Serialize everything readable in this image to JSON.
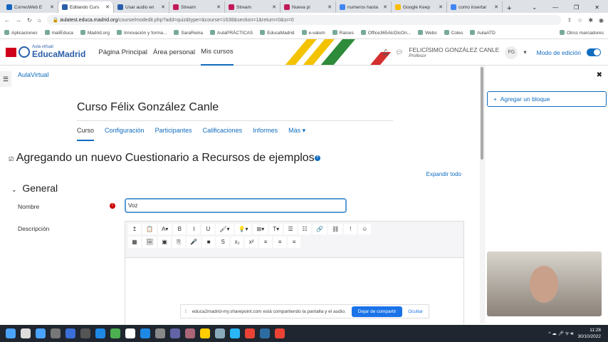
{
  "browser": {
    "tabs": [
      {
        "label": "CorreoWeb E",
        "color": "#1565c0"
      },
      {
        "label": "Editando Curs",
        "color": "#2a5ea8",
        "active": true
      },
      {
        "label": "Usar audio en",
        "color": "#2a5ea8"
      },
      {
        "label": "Stream",
        "color": "#c2185b"
      },
      {
        "label": "Stream",
        "color": "#c2185b"
      },
      {
        "label": "Nueva pi",
        "color": "#c2185b"
      },
      {
        "label": "numeros hasta",
        "color": "#4285f4"
      },
      {
        "label": "Google Keep",
        "color": "#fbbc04"
      },
      {
        "label": "como insertar",
        "color": "#4285f4"
      }
    ],
    "url_host": "aulatest.educa.madrid.org",
    "url_path": "/course/modedit.php?add=quiz&type=&course=1638&section=1&return=0&sr=0",
    "bookmarks": [
      "Aplicaciones",
      "mailEduca",
      "Madrid.org",
      "Innovación y forma...",
      "SaraReina",
      "AulaPRÁCTICAS",
      "EducaMadrid",
      "e-valum",
      "Raíces",
      "Office365AlcDlcOn...",
      "Webs",
      "Coles",
      "AulaATD",
      "Otros marcadores"
    ]
  },
  "nav": {
    "logo_small": "Aula virtual",
    "logo_big": "EducaMadrid",
    "links": [
      "Página Principal",
      "Área personal",
      "Mis cursos"
    ],
    "user_name": "FELICÍSIMO GONZÁLEZ CANLE",
    "user_role": "Profesor",
    "initials": "FG",
    "edit_mode": "Modo de edición",
    "edit_on": true
  },
  "breadcrumb": "AulaVirtual",
  "course_title": "Curso Félix González Canle",
  "course_tabs": [
    "Curso",
    "Configuración",
    "Participantes",
    "Calificaciones",
    "Informes",
    "Más ▾"
  ],
  "page_heading": "Agregando un nuevo Cuestionario a Recursos de ejemplos",
  "expand_all": "Expandir todo",
  "section": "General",
  "form": {
    "name_label": "Nombre",
    "name_value": "Voz",
    "desc_label": "Descripción"
  },
  "editor_toolbar_row1": [
    "↥",
    "📋",
    "A▾",
    "B",
    "I",
    "U",
    "🖌▾",
    "💡▾",
    "⊞▾",
    "T▾",
    "☰",
    "☷",
    "🔗",
    "⛓",
    "!",
    "☺"
  ],
  "editor_toolbar_row2": [
    "▦",
    "🖼",
    "▣",
    "⎘",
    "🎤",
    "■",
    "S",
    "x₂",
    "x²",
    "≡",
    "≡",
    "≡"
  ],
  "drawer": {
    "add_block": "Agregar un bloque"
  },
  "share_bar": {
    "message": "educa2madrid-my.sharepoint.com está compartiendo la pantalla y el audio.",
    "stop": "Dejar de compartir",
    "hide": "Ocultar"
  },
  "taskbar": {
    "time": "11:28",
    "date": "30/10/2022",
    "icon_colors": [
      "#4aa3ff",
      "#ddd",
      "#4aa3ff",
      "#777",
      "#3a6fd8",
      "#555",
      "#1e88e5",
      "#4caf50",
      "#fff",
      "#1e88e5",
      "#888",
      "#6264a7",
      "#a67",
      "#fc0",
      "#8ab",
      "#29b6f6",
      "#ea4335",
      "#2d6ca2",
      "#ea4335"
    ]
  }
}
